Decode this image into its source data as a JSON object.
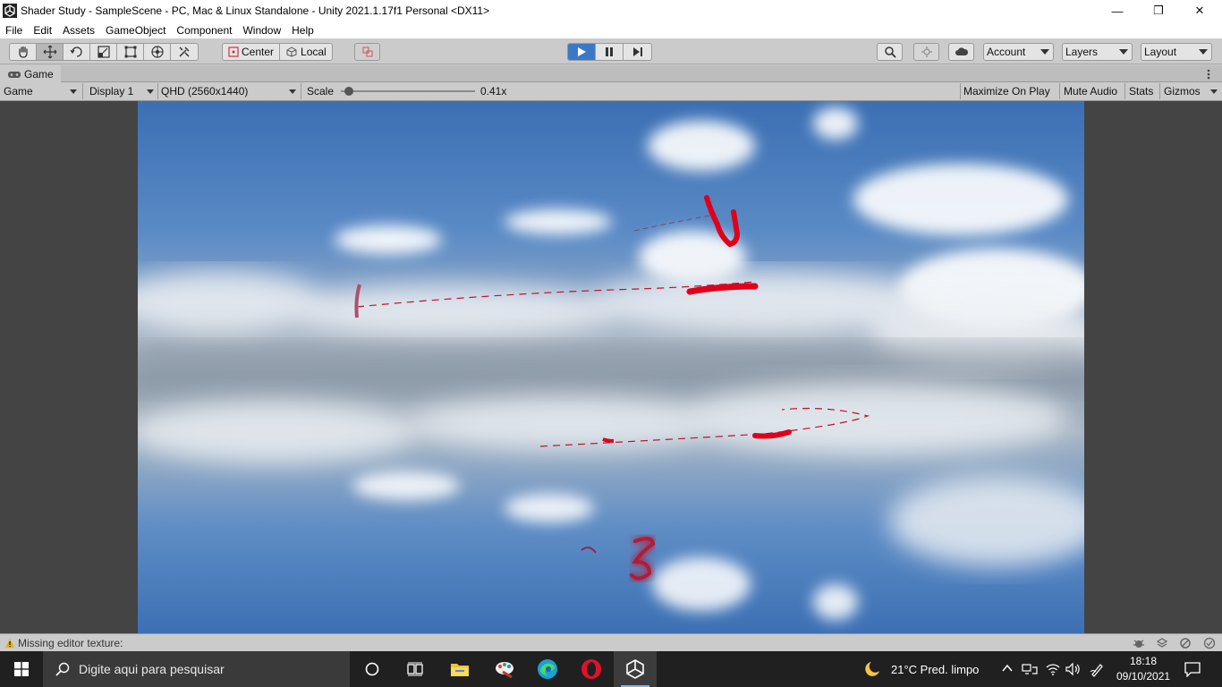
{
  "window": {
    "title": "Shader Study - SampleScene - PC, Mac & Linux Standalone - Unity 2021.1.17f1 Personal <DX11>",
    "minimize": "—",
    "maximize": "❐",
    "close": "✕"
  },
  "menu": [
    "File",
    "Edit",
    "Assets",
    "GameObject",
    "Component",
    "Window",
    "Help"
  ],
  "toolbar": {
    "tools": [
      "hand-tool",
      "move-tool",
      "rotate-tool",
      "scale-tool",
      "rect-tool",
      "transform-tool",
      "custom-tool"
    ],
    "pivot_label": "Center",
    "space_label": "Local",
    "account_label": "Account",
    "layers_label": "Layers",
    "layout_label": "Layout",
    "play_state": "playing"
  },
  "tab": {
    "label": "Game"
  },
  "gamebar": {
    "mode": "Game",
    "display": "Display 1",
    "resolution": "QHD (2560x1440)",
    "scale_label": "Scale",
    "scale_value": "0.41x",
    "scale_fraction": 0.03,
    "maximize_on_play": "Maximize On Play",
    "mute_audio": "Mute Audio",
    "stats": "Stats",
    "gizmos": "Gizmos"
  },
  "status": {
    "message": "Missing editor texture:"
  },
  "taskbar": {
    "search_placeholder": "Digite aqui para pesquisar",
    "apps": [
      "cortana-icon",
      "task-view-icon",
      "file-explorer-icon",
      "paint-icon",
      "edge-icon",
      "opera-icon",
      "unity-icon"
    ],
    "weather": "21°C  Pred. limpo",
    "time": "18:18",
    "date": "09/10/2021"
  },
  "colors": {
    "sky_top": "#3f74b8",
    "sky_mid": "#9fb3c9",
    "trail": "#e0001a",
    "play_active": "#3a79c5"
  }
}
